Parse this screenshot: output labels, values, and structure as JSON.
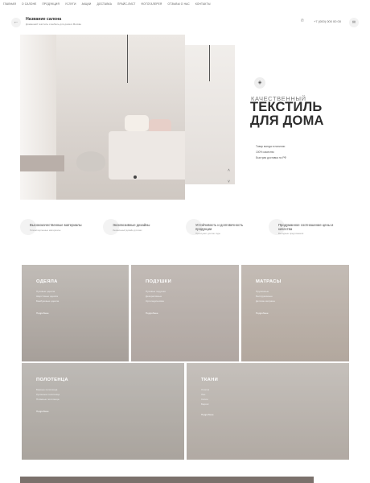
{
  "nav": [
    "Главная",
    "О салоне",
    "Продукция",
    "Услуги",
    "Акции",
    "Доставка",
    "Прайс-лист",
    "Фотогалерея",
    "Отзывы о нас",
    "Контакты"
  ],
  "header": {
    "back_icon": "arrow-left-icon",
    "title": "Название салона",
    "subtitle": "Домашний текстиль и мебель для дома в Москве",
    "phone": "+7 (000) 000 00 00",
    "phone_icon": "phone-icon",
    "message_icon": "chat-icon"
  },
  "hero": {
    "tag_icon": "fabric-icon",
    "subtitle": "КАЧЕСТВЕННЫЙ",
    "title_line1": "ТЕКСТИЛЬ",
    "title_line2": "ДЛЯ ДОМА",
    "features": [
      "Товар всегда в наличии",
      "100% качество",
      "Быстрая доставка по РФ"
    ],
    "arrow_up": "˄",
    "arrow_down": "˅"
  },
  "benefits": [
    {
      "title": "Высококачественные материалы",
      "sub": "Гипоаллергенные материалы"
    },
    {
      "title": "Эксклюзивные дизайны",
      "sub": "Уникальный дизайн для вас"
    },
    {
      "title": "Устойчивость и долговечность продукции",
      "sub": "Прослужит долгие годы"
    },
    {
      "title": "Продуманное соотношение цены и качества",
      "sub": "Выгодные предложения"
    }
  ],
  "categories": [
    {
      "title": "ОДЕЯЛА",
      "lines": [
        "Пуховые одеяла",
        "Шерстяные одеяла",
        "Бамбуковые одеяла"
      ],
      "more": "Подробнее"
    },
    {
      "title": "ПОДУШКИ",
      "lines": [
        "Пуховые подушки",
        "Декоративные",
        "Ортопедические"
      ],
      "more": "Подробнее"
    },
    {
      "title": "МАТРАСЫ",
      "lines": [
        "Пружинные",
        "Беспружинные",
        "Детские матрасы"
      ],
      "more": "Подробнее"
    },
    {
      "title": "ПОЛОТЕНЦА",
      "lines": [
        "Банные полотенца",
        "Кухонные полотенца",
        "Пляжные полотенца"
      ],
      "more": "Подробнее"
    },
    {
      "title": "ТКАНИ",
      "lines": [
        "Хлопок",
        "Лен",
        "Сатин",
        "Бархат"
      ],
      "more": "Подробнее"
    }
  ]
}
